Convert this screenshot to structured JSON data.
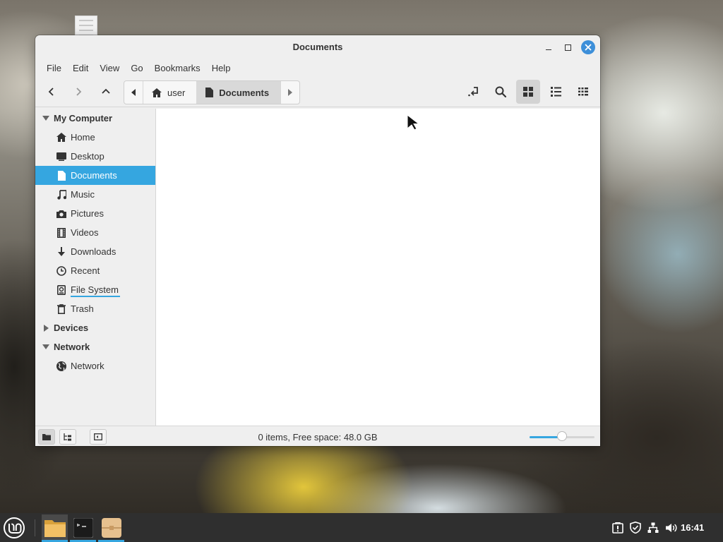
{
  "window": {
    "title": "Documents"
  },
  "menu": [
    "File",
    "Edit",
    "View",
    "Go",
    "Bookmarks",
    "Help"
  ],
  "pathbar": {
    "segments": [
      "user",
      "Documents"
    ]
  },
  "sidebar": {
    "sections": [
      {
        "label": "My Computer",
        "expanded": true
      },
      {
        "label": "Devices",
        "expanded": false
      },
      {
        "label": "Network",
        "expanded": true
      }
    ],
    "my_computer_items": [
      {
        "label": "Home",
        "icon": "home-icon"
      },
      {
        "label": "Desktop",
        "icon": "desktop-icon"
      },
      {
        "label": "Documents",
        "icon": "document-icon",
        "selected": true
      },
      {
        "label": "Music",
        "icon": "music-icon"
      },
      {
        "label": "Pictures",
        "icon": "camera-icon"
      },
      {
        "label": "Videos",
        "icon": "film-icon"
      },
      {
        "label": "Downloads",
        "icon": "download-icon"
      },
      {
        "label": "Recent",
        "icon": "clock-icon"
      },
      {
        "label": "File System",
        "icon": "drive-icon"
      },
      {
        "label": "Trash",
        "icon": "trash-icon"
      }
    ],
    "network_items": [
      {
        "label": "Network",
        "icon": "globe-icon"
      }
    ]
  },
  "status": {
    "text": "0 items, Free space: 48.0 GB",
    "zoom_level": 0.5
  },
  "taskbar": {
    "time": "16:41"
  },
  "colors": {
    "accent": "#35a6e0",
    "taskbar": "#2f2f2f"
  }
}
